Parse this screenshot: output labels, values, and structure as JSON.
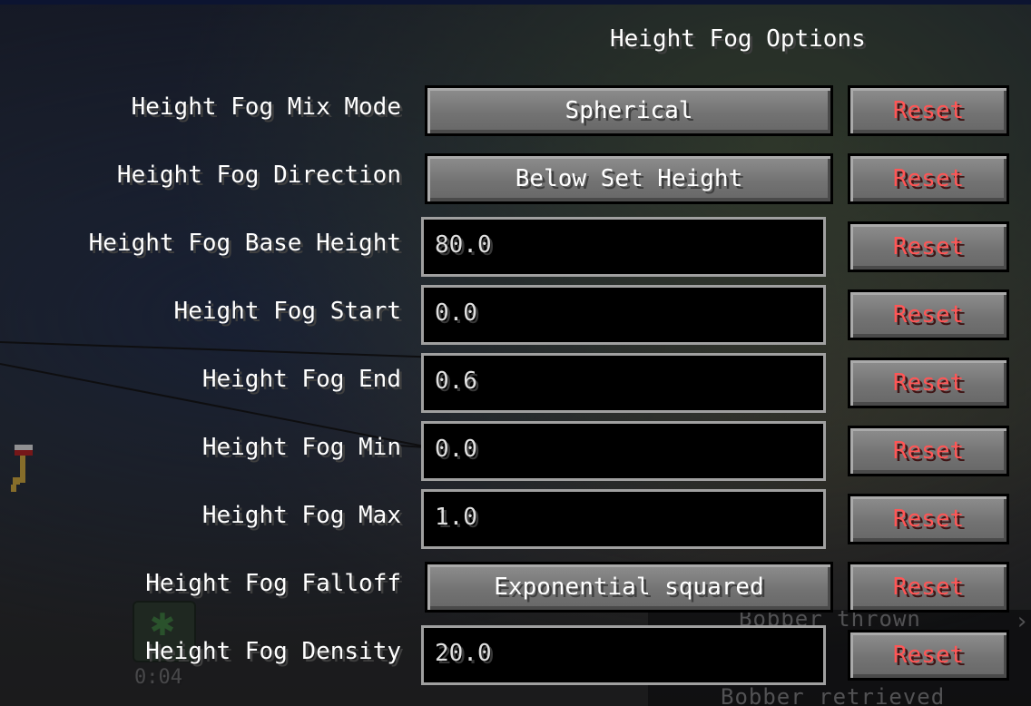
{
  "screen": {
    "title": "Height Fog Options",
    "reset_label": "Reset"
  },
  "options": [
    {
      "label": "Height Fog Mix Mode",
      "kind": "button",
      "value": "Spherical"
    },
    {
      "label": "Height Fog Direction",
      "kind": "button",
      "value": "Below Set Height"
    },
    {
      "label": "Height Fog Base Height",
      "kind": "field",
      "value": "80.0"
    },
    {
      "label": "Height Fog Start",
      "kind": "field",
      "value": "0.0"
    },
    {
      "label": "Height Fog End",
      "kind": "field",
      "value": "0.6"
    },
    {
      "label": "Height Fog Min",
      "kind": "field",
      "value": "0.0"
    },
    {
      "label": "Height Fog Max",
      "kind": "field",
      "value": "1.0"
    },
    {
      "label": "Height Fog Falloff",
      "kind": "button",
      "value": "Exponential squared"
    },
    {
      "label": "Height Fog Density",
      "kind": "field",
      "value": "20.0"
    }
  ],
  "hud": {
    "timer": "0:04",
    "subtitles": [
      "Bobber thrown",
      "Bobber retrieved"
    ]
  },
  "colors": {
    "reset_text": "#ff5555",
    "field_border": "#a0a0a0",
    "field_bg": "#000000",
    "button_face": "#737373"
  }
}
